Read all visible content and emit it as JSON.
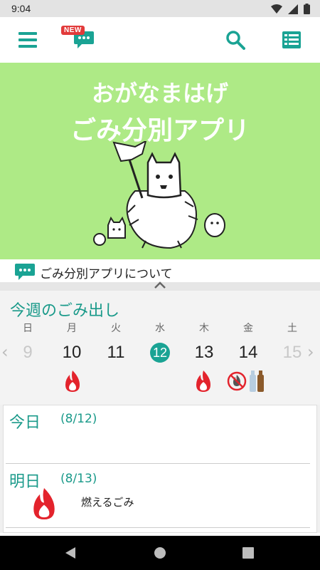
{
  "status_bar": {
    "time": "9:04"
  },
  "toolbar": {
    "new_badge": "NEW"
  },
  "banner": {
    "title_line1": "おがなまはげ",
    "title_line2": "ごみ分別アプリ"
  },
  "about": {
    "label": "ごみ分別アプリについて"
  },
  "week": {
    "title": "今週のごみ出し",
    "days": [
      {
        "dow": "日",
        "date": "9",
        "faded": true
      },
      {
        "dow": "月",
        "date": "10"
      },
      {
        "dow": "火",
        "date": "11"
      },
      {
        "dow": "水",
        "date": "12",
        "today": true
      },
      {
        "dow": "木",
        "date": "13"
      },
      {
        "dow": "金",
        "date": "14"
      },
      {
        "dow": "土",
        "date": "15",
        "faded": true
      }
    ],
    "prev_arrow": "‹",
    "next_arrow": "›"
  },
  "schedule": {
    "today": {
      "label": "今日",
      "date": "(8/12)"
    },
    "tomorrow": {
      "label": "明日",
      "date": "(8/13)",
      "item": "燃えるごみ"
    }
  },
  "colors": {
    "accent": "#1aa394",
    "banner": "#aeea86",
    "flame": "#e3232c"
  }
}
